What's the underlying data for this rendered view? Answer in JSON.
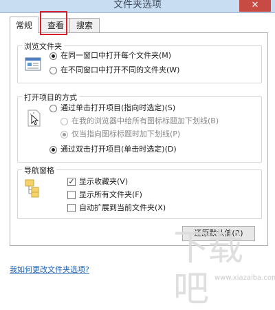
{
  "window": {
    "title": "文件夹选项",
    "close_glyph": "✕"
  },
  "tabs": [
    {
      "label": "常规",
      "active": true
    },
    {
      "label": "查看",
      "active": false
    },
    {
      "label": "搜索",
      "active": false
    }
  ],
  "browse": {
    "title": "浏览文件夹",
    "options": [
      {
        "label": "在同一窗口中打开每个文件夹(M)",
        "checked": true
      },
      {
        "label": "在不同窗口中打开不同的文件夹(W)",
        "checked": false
      }
    ],
    "icon": "window-icon"
  },
  "open_items": {
    "title": "打开项目的方式",
    "icon": "click-cursor-icon",
    "single_click": {
      "label": "通过单击打开项目(指向时选定)(S)",
      "checked": false
    },
    "sub_options": [
      {
        "label": "在我的浏览器中给所有图标标题加下划线(B)",
        "checked": false
      },
      {
        "label": "仅当指向图标标题时加下划线(P)",
        "checked": true
      }
    ],
    "double_click": {
      "label": "通过双击打开项目(单击时选定)(D)",
      "checked": true
    }
  },
  "nav_pane": {
    "title": "导航窗格",
    "icon": "folder-tree-icon",
    "options": [
      {
        "label": "显示收藏夹(V)",
        "checked": true
      },
      {
        "label": "显示所有文件夹(F)",
        "checked": false
      },
      {
        "label": "自动扩展到当前文件夹(X)",
        "checked": false
      }
    ]
  },
  "restore_button": "还原默认值(R)",
  "help_link": "我如何更改文件夹选项?",
  "watermark": {
    "main": "下载吧",
    "sub": "www.xiazaiba.com"
  },
  "colors": {
    "highlight": "#d9202a",
    "link": "#1a5fb4",
    "close": "#c74a43"
  }
}
